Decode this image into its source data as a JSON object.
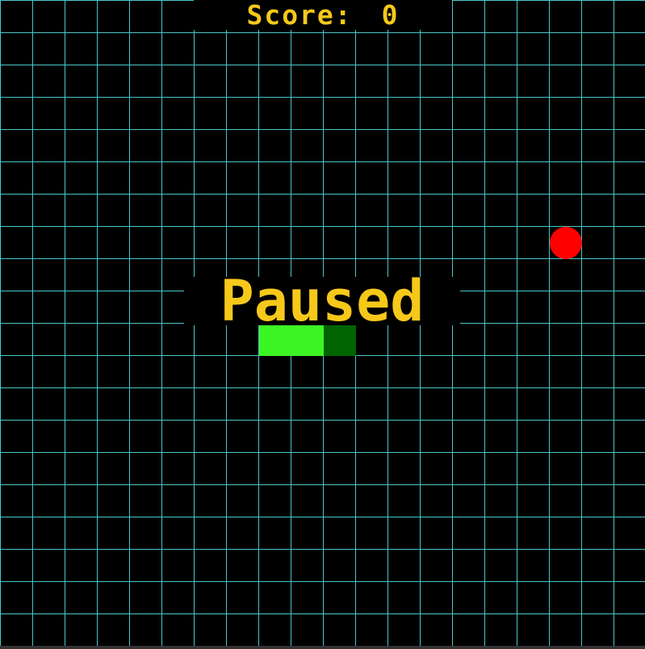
{
  "hud": {
    "score_label": "Score:",
    "score_value": "0"
  },
  "status": {
    "paused_text": "Paused"
  },
  "snake": {
    "segments": [
      {
        "col": 8,
        "row": 10,
        "part": "body"
      },
      {
        "col": 9,
        "row": 10,
        "part": "body"
      },
      {
        "col": 10,
        "row": 10,
        "part": "head"
      }
    ]
  },
  "food": {
    "col": 17,
    "row": 7
  },
  "colors": {
    "background": "#000000",
    "grid_line": "#49c6c9",
    "text": "#f6c81a",
    "snake_body": "#3df524",
    "snake_head": "#006400",
    "food": "#ff0000"
  }
}
